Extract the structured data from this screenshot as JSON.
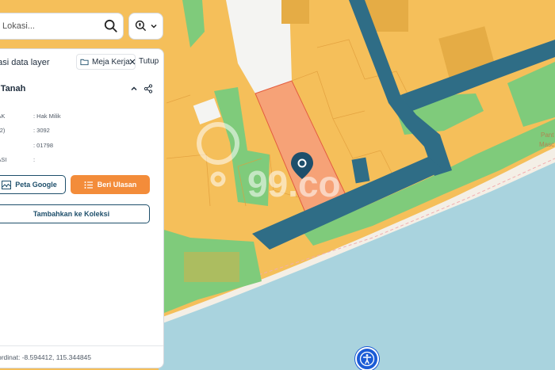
{
  "search": {
    "placeholder": "Lokasi..."
  },
  "panel": {
    "title": "nasi data layer",
    "workspace_label": "Meja Kerja",
    "close_label": "Tutup",
    "section_title": "g Tanah",
    "rows": [
      {
        "key": "HAK",
        "value": ": Hak Milik"
      },
      {
        "key": "(M2)",
        "value": ": 3092"
      },
      {
        "key": "",
        "value": ": 01798"
      },
      {
        "key": "RASI",
        "value": ":"
      }
    ],
    "btn_google": "Peta Google",
    "btn_review": "Beri Ulasan",
    "btn_collection": "Tambahkan ke Koleksi",
    "footer": "ordinat: -8.594412, 115.344845"
  },
  "map": {
    "watermark": "99.co",
    "labels": [
      "Pant",
      "Masc"
    ],
    "colors": {
      "sea": "#a9d3de",
      "beach": "#f4efe6",
      "residential": "#f5bf5a",
      "selected_parcel": "#f6a277",
      "green_zone": "#7fcb7b",
      "road": "#2f6d86",
      "white_zone": "#f4f4f2"
    }
  },
  "icons": {
    "search": "search-icon",
    "layer": "map-layer-icon",
    "workspace": "folder-icon",
    "close": "close-icon",
    "collapse": "chevron-up-icon",
    "share": "share-icon",
    "google_map": "map-icon",
    "review": "list-icon",
    "pin": "location-pin-icon",
    "accessibility": "accessibility-icon"
  }
}
